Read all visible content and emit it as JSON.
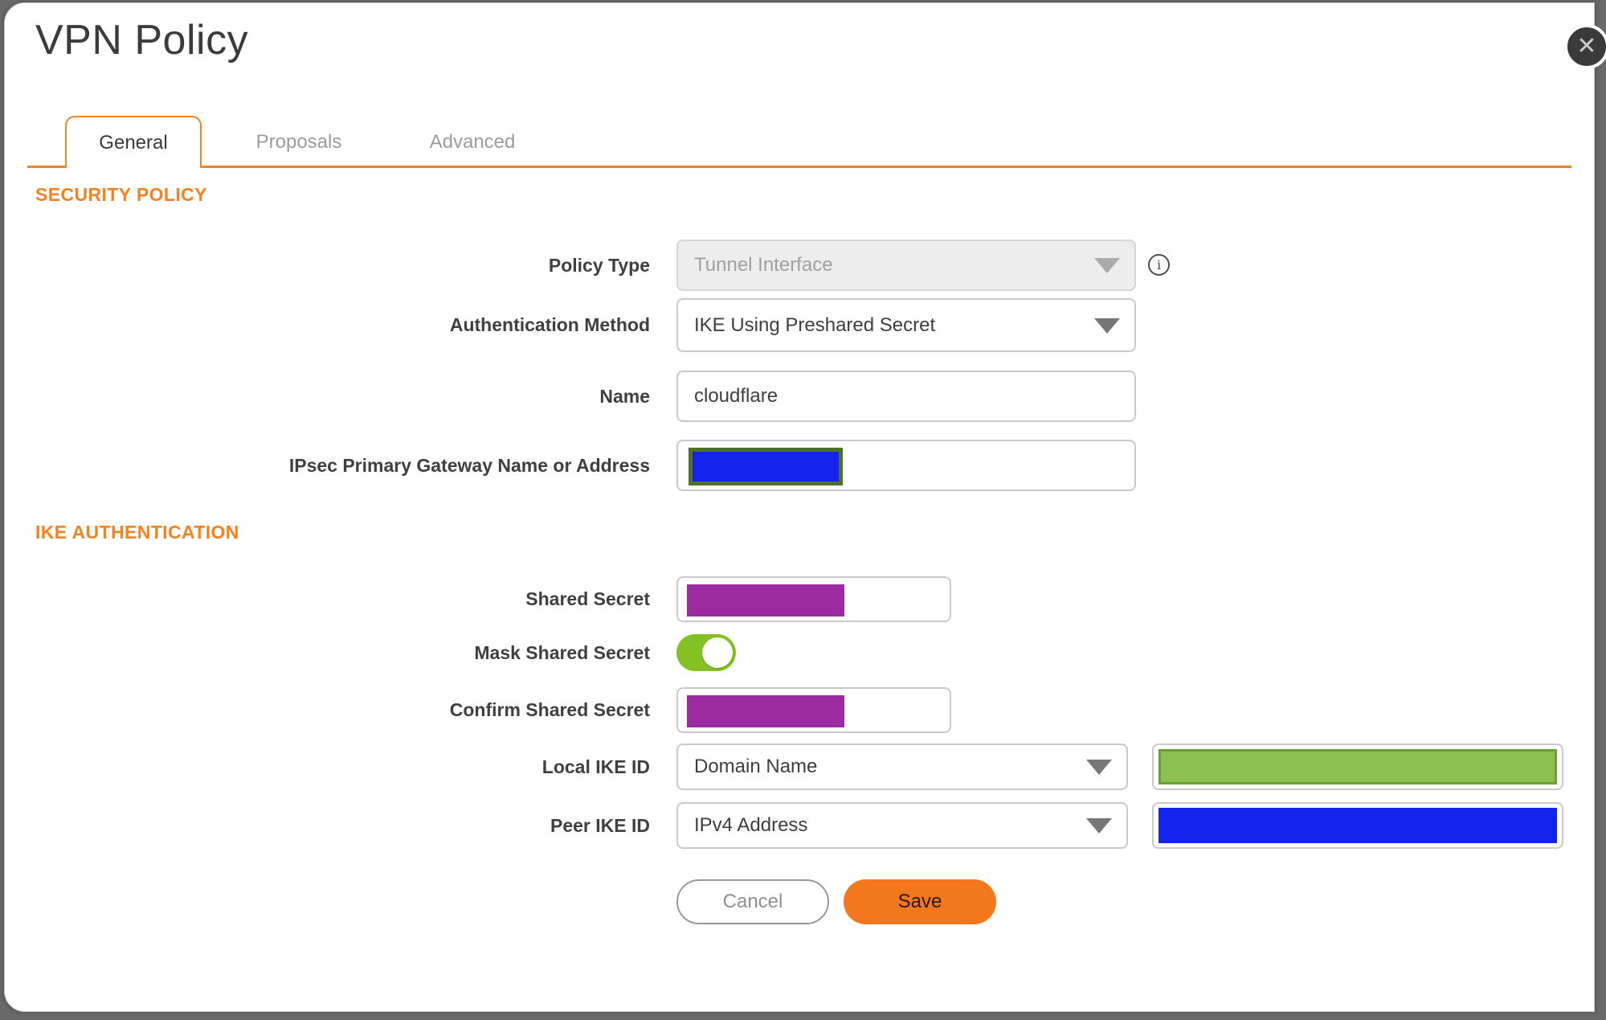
{
  "dialog": {
    "title": "VPN Policy"
  },
  "icons": {
    "close": "✕",
    "info": "i"
  },
  "tabs": [
    {
      "label": "General",
      "active": true
    },
    {
      "label": "Proposals",
      "active": false
    },
    {
      "label": "Advanced",
      "active": false
    }
  ],
  "sections": {
    "security_policy": "SECURITY POLICY",
    "ike_authentication": "IKE AUTHENTICATION"
  },
  "fields": {
    "policy_type": {
      "label": "Policy Type",
      "value": "Tunnel Interface",
      "disabled": true
    },
    "authentication_method": {
      "label": "Authentication Method",
      "value": "IKE Using Preshared Secret"
    },
    "name": {
      "label": "Name",
      "value": "cloudflare"
    },
    "ipsec_gateway": {
      "label": "IPsec Primary Gateway Name or Address",
      "value": "",
      "redaction": "blue-box-with-olive-border"
    },
    "shared_secret": {
      "label": "Shared Secret",
      "value": "",
      "redaction": "purple-box"
    },
    "mask_shared_secret": {
      "label": "Mask Shared Secret",
      "state": "on"
    },
    "confirm_shared_secret": {
      "label": "Confirm Shared Secret",
      "value": "",
      "redaction": "purple-box"
    },
    "local_ike_id": {
      "label": "Local IKE ID",
      "value": "Domain Name",
      "redaction": "green-box"
    },
    "peer_ike_id": {
      "label": "Peer IKE ID",
      "value": "IPv4 Address",
      "redaction": "blue-box"
    }
  },
  "buttons": {
    "cancel": "Cancel",
    "save": "Save"
  },
  "colors": {
    "accent_orange": "#f5821f",
    "save_orange": "#f5771d",
    "toggle_green": "#83c222",
    "redaction_purple": "#9c2ba1",
    "redaction_blue": "#1424ec",
    "redaction_green": "#8cc152",
    "green_border": "#68a036",
    "olive_border": "#4e7227"
  }
}
